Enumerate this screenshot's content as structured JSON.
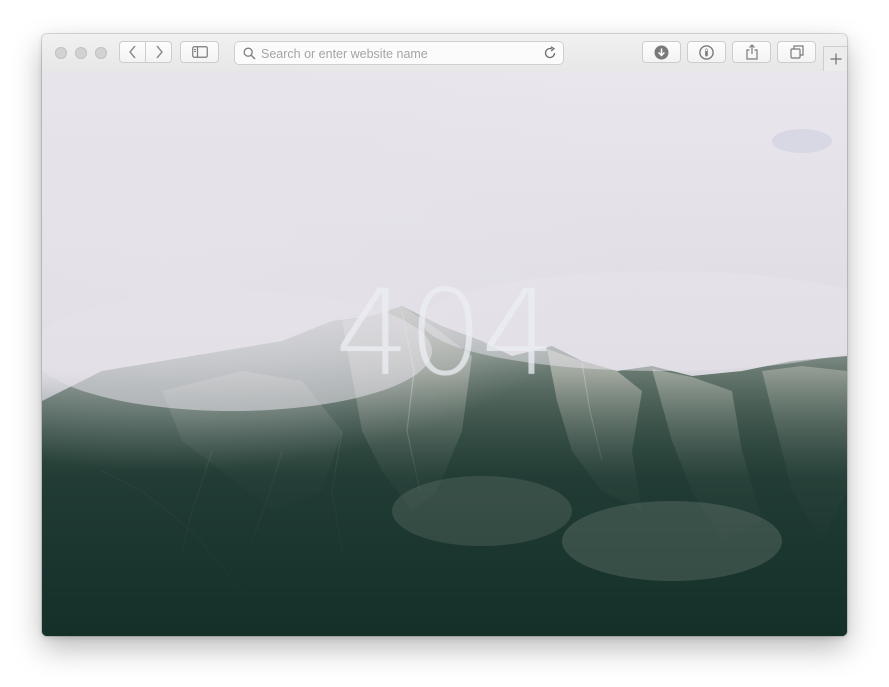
{
  "browser": {
    "address_bar": {
      "placeholder": "Search or enter website name"
    },
    "toolbar_icons": [
      "chevron-left-icon",
      "chevron-right-icon",
      "sidebar-icon",
      "search-icon",
      "reload-icon",
      "download-icon",
      "info-icon",
      "share-icon",
      "tabs-icon",
      "plus-icon"
    ]
  },
  "page": {
    "error_code": "404",
    "background": "foggy mountain photograph"
  },
  "colors": {
    "toolbar": "#ececec",
    "fog": "#e9e5ef",
    "forest": "#1e3a36",
    "text_overlay": "#e8ecf2"
  }
}
